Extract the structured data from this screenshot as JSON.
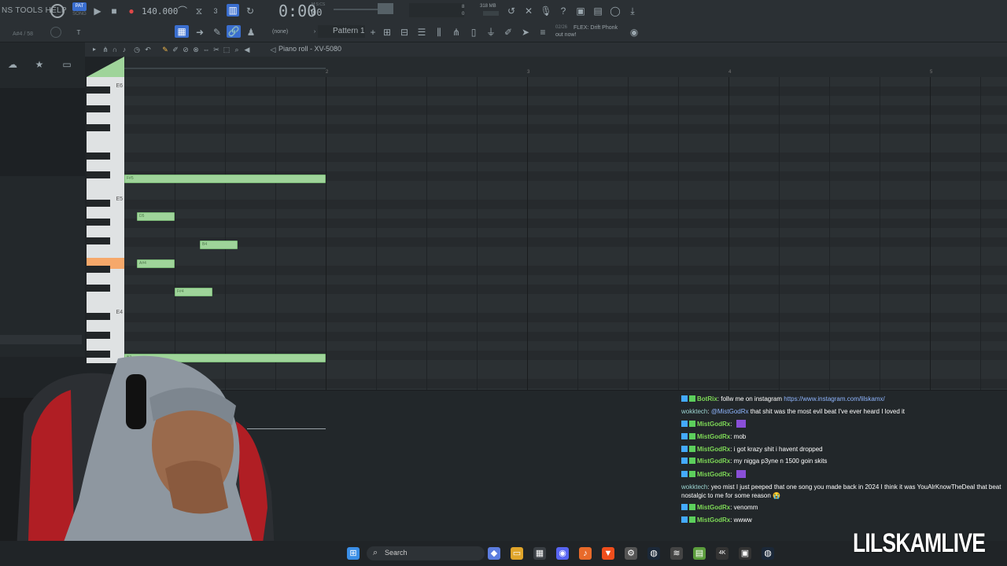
{
  "menu": {
    "items_text": "NS TOOLS HELP"
  },
  "transport": {
    "pat_label": "PAT",
    "song_label": "SONG",
    "tempo": "140.000",
    "time": "0:00",
    "time_frac": "00",
    "time_unit": "M:S:CS",
    "cpu_mem": "318 MB",
    "cpu_top": "8",
    "cpu_bot": "0"
  },
  "hint": {
    "text": "A#4 / 58"
  },
  "toolbar2": {
    "pattern_selector": "(none)",
    "pattern_name": "Pattern 1",
    "news_date": "02/26",
    "news_text": "FLEX: Drift Phonk",
    "news_text2": "out now!"
  },
  "piano_roll": {
    "title": "Piano roll - XV-5080",
    "ruler_marks": [
      "2",
      "3",
      "4",
      "5"
    ],
    "octave_labels": [
      "E6",
      "E5",
      "E4"
    ],
    "notes": [
      {
        "label": "F#5",
        "start": 0,
        "len": 4,
        "row": 10
      },
      {
        "label": "D5",
        "start": 0.25,
        "len": 0.75,
        "row": 14
      },
      {
        "label": "B4",
        "start": 1.5,
        "len": 0.75,
        "row": 17
      },
      {
        "label": "A#4",
        "start": 0.25,
        "len": 0.75,
        "row": 19
      },
      {
        "label": "F#4",
        "start": 1.0,
        "len": 0.75,
        "row": 22
      },
      {
        "label": "B3",
        "start": 0,
        "len": 4,
        "row": 29
      }
    ]
  },
  "chat": {
    "lines": [
      {
        "user": "BotRix",
        "text": ": follw me on instagram ",
        "link": "https://www.instagram.com/lilskamx/",
        "badge": true
      },
      {
        "user": "wokktech",
        "text": ": ",
        "mention": "@MistGodRx",
        "text2": " that shit was the most evil beat I've ever heard I loved it",
        "badge": false
      },
      {
        "user": "MistGodRx",
        "text": ":",
        "emote": true,
        "badge": true
      },
      {
        "user": "MistGodRx",
        "text": ": mob",
        "badge": true
      },
      {
        "user": "MistGodRx",
        "text": ": i got krazy shit i havent dropped",
        "badge": true
      },
      {
        "user": "MistGodRx",
        "text": ": my nigga p3yne n 1500 goin skits",
        "badge": true
      },
      {
        "user": "MistGodRx",
        "text": ":",
        "emote": true,
        "badge": true
      },
      {
        "user": "wokktech",
        "text": ": yeo mist I just peeped that one song you made back in 2024 I think it was YouAlrKnowTheDeal that beat",
        "text_line2": "nostalgic to me for some reason 😭",
        "badge": false
      },
      {
        "user": "MistGodRx",
        "text": ": venomm",
        "badge": true
      },
      {
        "user": "MistGodRx",
        "text": ": wwww",
        "badge": true
      }
    ]
  },
  "taskbar": {
    "search_label": "Search"
  },
  "watermark": "LILSKAMLIVE",
  "colors": {
    "note": "#9fd49a",
    "accent": "#3a6ecf",
    "highlight_key": "#f6a86a",
    "chat_user": "#7ed957"
  }
}
